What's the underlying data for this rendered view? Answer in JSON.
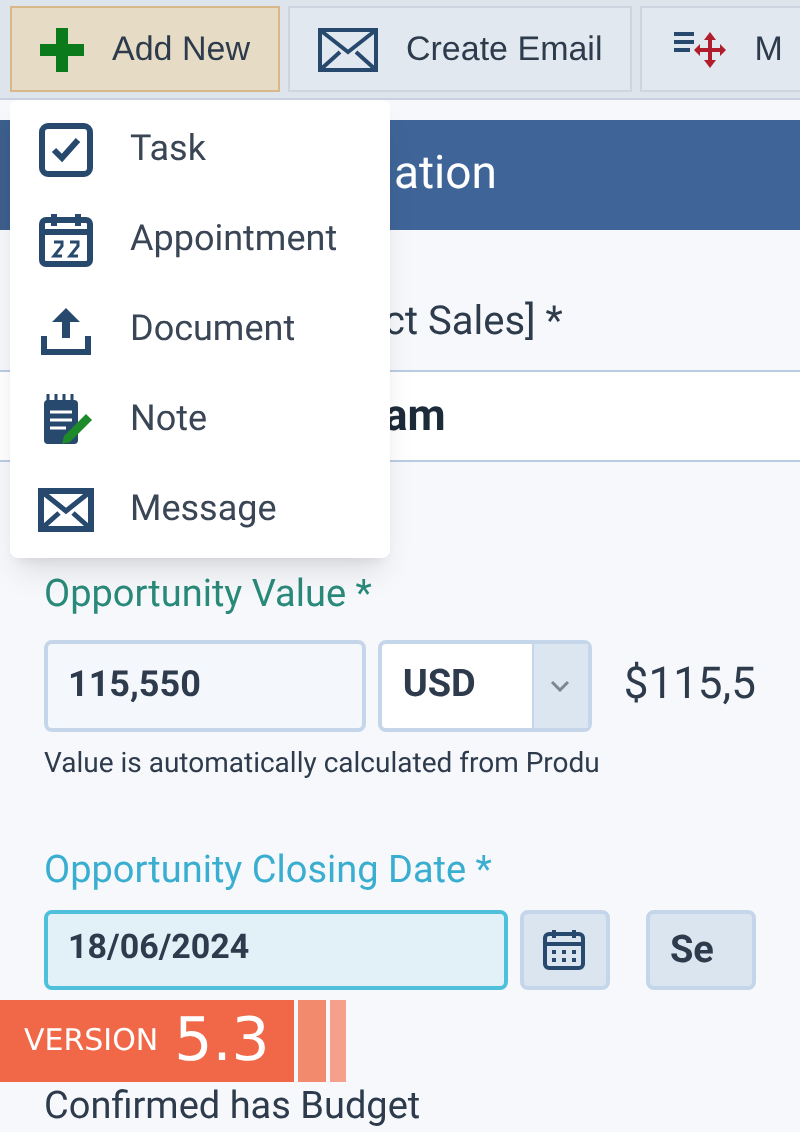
{
  "toolbar": {
    "buttons": [
      {
        "label": "Add New",
        "kind": "add",
        "selected": true
      },
      {
        "label": "Create Email",
        "kind": "email",
        "selected": false
      },
      {
        "label": "M",
        "kind": "merge",
        "selected": false
      }
    ]
  },
  "menu": {
    "items": [
      {
        "label": "Task",
        "kind": "task"
      },
      {
        "label": "Appointment",
        "kind": "appointment"
      },
      {
        "label": "Document",
        "kind": "document"
      },
      {
        "label": "Note",
        "kind": "note"
      },
      {
        "label": "Message",
        "kind": "message"
      }
    ]
  },
  "panel": {
    "title": "ation"
  },
  "name_field": {
    "label": "ct Sales] *",
    "value": "am"
  },
  "value_field": {
    "label": "Opportunity Value *",
    "amount": "115,550",
    "currency": "USD",
    "display": "$115,5",
    "help": "Value is automatically calculated from Produ"
  },
  "date_field": {
    "label": "Opportunity Closing Date *",
    "value": "18/06/2024",
    "focused": true,
    "button": "Se"
  },
  "budget_label": "Confirmed has Budget",
  "badge": {
    "prefix": "VERSION",
    "number": "5.3"
  }
}
